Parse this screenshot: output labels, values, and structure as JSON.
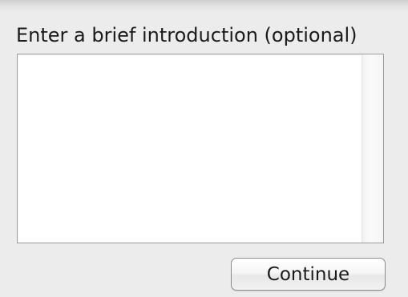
{
  "prompt": {
    "label": "Enter a brief introduction (optional)"
  },
  "intro_field": {
    "value": "",
    "placeholder": ""
  },
  "actions": {
    "continue_label": "Continue"
  }
}
